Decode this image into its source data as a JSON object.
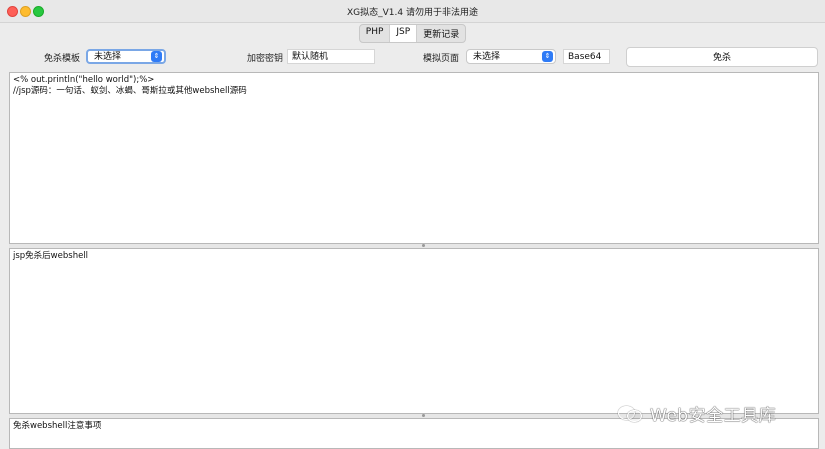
{
  "window": {
    "title": "XG拟态_V1.4 请勿用于非法用途"
  },
  "tabs": [
    {
      "label": "PHP",
      "active": false
    },
    {
      "label": "JSP",
      "active": true
    },
    {
      "label": "更新记录",
      "active": false
    }
  ],
  "toolbar": {
    "template_label": "免杀模板",
    "template_value": "未选择",
    "key_label": "加密密钥",
    "key_value": "默认随机",
    "page_label": "模拟页面",
    "page_value": "未选择",
    "encoding_value": "Base64",
    "run_button": "免杀"
  },
  "editor": {
    "input_lines": "<% out.println(\"hello world\");%>\n//jsp源码：一句话、蚁剑、冰蝎、哥斯拉或其他webshell源码",
    "output_text": "jsp免杀后webshell",
    "notes_text": "免杀webshell注意事项"
  },
  "watermark": {
    "text": "Web安全工具库"
  },
  "colors": {
    "accent": "#2f7bf6",
    "close": "#fe5f57",
    "minimize": "#febc2e",
    "maximize": "#28c840"
  }
}
